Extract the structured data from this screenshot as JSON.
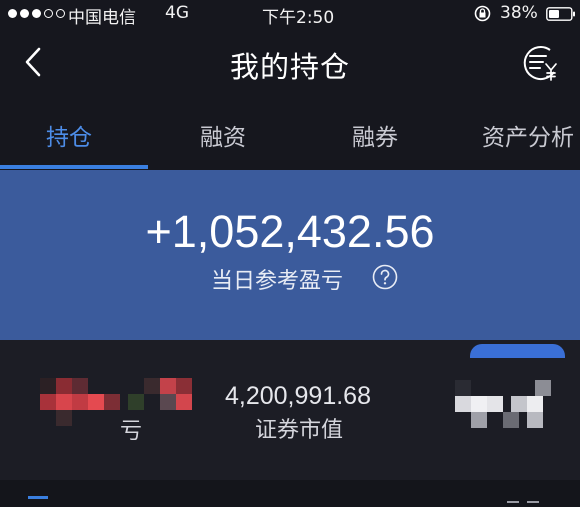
{
  "status_bar": {
    "carrier": "中国电信",
    "network": "4G",
    "time": "下午2:50",
    "battery": "38%"
  },
  "nav": {
    "title": "我的持仓",
    "back_icon": "chevron-left-icon",
    "right_icon": "ledger-yuan-icon"
  },
  "tabs": [
    {
      "label": "持仓",
      "active": true
    },
    {
      "label": "融资",
      "active": false
    },
    {
      "label": "融券",
      "active": false
    },
    {
      "label": "资产分析",
      "active": false
    }
  ],
  "summary": {
    "daily_pnl": "+1,052,432.56",
    "daily_pnl_label": "当日参考盈亏",
    "help_icon": "question-circle-icon"
  },
  "stats": {
    "left_label": "亏",
    "market_value": "4,200,991.68",
    "market_value_label": "证券市值"
  },
  "colors": {
    "background": "#16171e",
    "panel": "#3b5b9c",
    "accent": "#3a7fe0"
  }
}
